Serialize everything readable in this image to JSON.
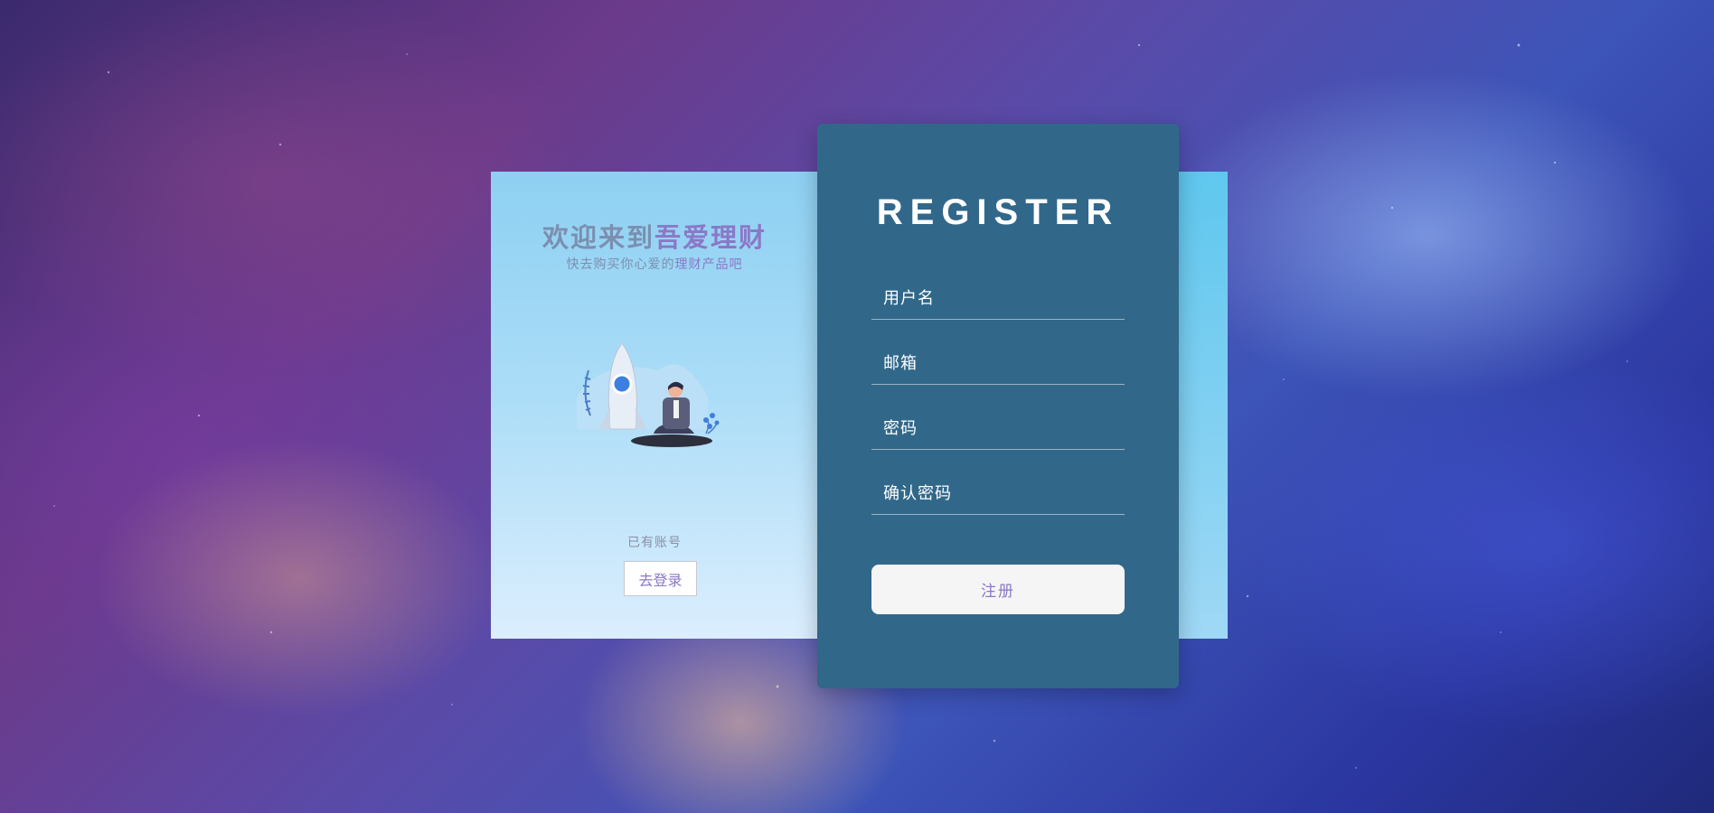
{
  "welcome": {
    "title_prefix": "欢迎来到",
    "title_brand": "吾爱理财",
    "subtitle_prefix": "快去购买你心爱的",
    "subtitle_brand": "理财产品吧",
    "has_account": "已有账号",
    "login_button": "去登录"
  },
  "register": {
    "title": "REGISTER",
    "username_placeholder": "用户名",
    "email_placeholder": "邮箱",
    "password_placeholder": "密码",
    "confirm_password_placeholder": "确认密码",
    "submit_label": "注册"
  },
  "colors": {
    "panel": "#31688a",
    "brand_purple": "#8a78c7",
    "card_light_blue": "#a9dcf7"
  }
}
